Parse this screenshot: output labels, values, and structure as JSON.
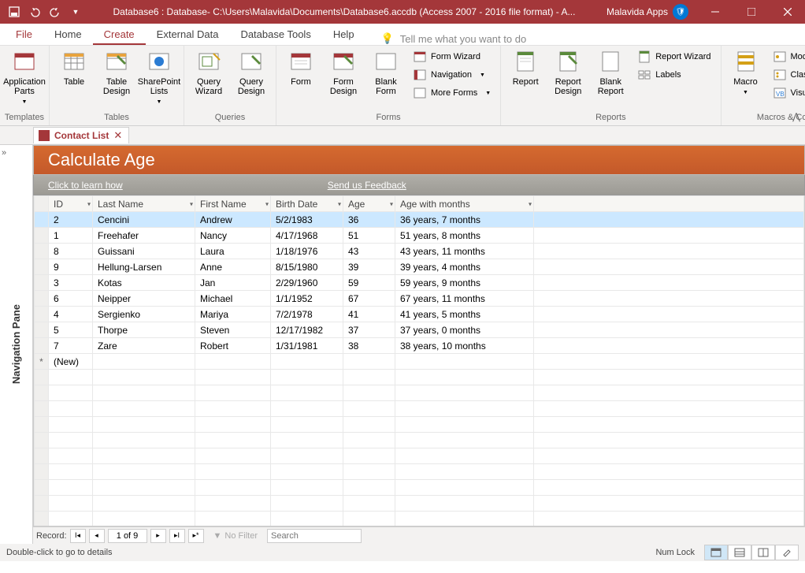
{
  "titlebar": {
    "title": "Database6 : Database- C:\\Users\\Malavida\\Documents\\Database6.accdb (Access 2007 - 2016 file format) -  A...",
    "app_badge": "Malavida Apps"
  },
  "ribbon": {
    "tabs": [
      "File",
      "Home",
      "Create",
      "External Data",
      "Database Tools",
      "Help"
    ],
    "active_tab": "Create",
    "tell_me_placeholder": "Tell me what you want to do",
    "groups": {
      "templates": {
        "label": "Templates",
        "application_parts": "Application\nParts"
      },
      "tables": {
        "label": "Tables",
        "table": "Table",
        "table_design": "Table\nDesign",
        "sharepoint_lists": "SharePoint\nLists"
      },
      "queries": {
        "label": "Queries",
        "query_wizard": "Query\nWizard",
        "query_design": "Query\nDesign"
      },
      "forms": {
        "label": "Forms",
        "form": "Form",
        "form_design": "Form\nDesign",
        "blank_form": "Blank\nForm",
        "form_wizard": "Form Wizard",
        "navigation": "Navigation",
        "more_forms": "More Forms"
      },
      "reports": {
        "label": "Reports",
        "report": "Report",
        "report_design": "Report\nDesign",
        "blank_report": "Blank\nReport",
        "report_wizard": "Report Wizard",
        "labels": "Labels"
      },
      "macros": {
        "label": "Macros & Code",
        "macro": "Macro",
        "module": "Module",
        "class_module": "Class Module",
        "visual_basic": "Visual Basic"
      }
    }
  },
  "doc_tab": {
    "label": "Contact List"
  },
  "nav_pane_label": "Navigation Pane",
  "form": {
    "title": "Calculate Age",
    "learn_link": "Click to learn how",
    "feedback_link": "Send us Feedback"
  },
  "grid": {
    "columns": [
      "ID",
      "Last Name",
      "First Name",
      "Birth Date",
      "Age",
      "Age with months"
    ],
    "new_row_label": "(New)",
    "rows": [
      {
        "id": "2",
        "last": "Cencini",
        "first": "Andrew",
        "birth": "5/2/1983",
        "age": "36",
        "agem": "36 years, 7 months"
      },
      {
        "id": "1",
        "last": "Freehafer",
        "first": "Nancy",
        "birth": "4/17/1968",
        "age": "51",
        "agem": "51 years, 8 months"
      },
      {
        "id": "8",
        "last": "Guissani",
        "first": "Laura",
        "birth": "1/18/1976",
        "age": "43",
        "agem": "43 years, 11 months"
      },
      {
        "id": "9",
        "last": "Hellung-Larsen",
        "first": "Anne",
        "birth": "8/15/1980",
        "age": "39",
        "agem": "39 years, 4 months"
      },
      {
        "id": "3",
        "last": "Kotas",
        "first": "Jan",
        "birth": "2/29/1960",
        "age": "59",
        "agem": "59 years, 9 months"
      },
      {
        "id": "6",
        "last": "Neipper",
        "first": "Michael",
        "birth": "1/1/1952",
        "age": "67",
        "agem": "67 years, 11 months"
      },
      {
        "id": "4",
        "last": "Sergienko",
        "first": "Mariya",
        "birth": "7/2/1978",
        "age": "41",
        "agem": "41 years, 5 months"
      },
      {
        "id": "5",
        "last": "Thorpe",
        "first": "Steven",
        "birth": "12/17/1982",
        "age": "37",
        "agem": "37 years, 0 months"
      },
      {
        "id": "7",
        "last": "Zare",
        "first": "Robert",
        "birth": "1/31/1981",
        "age": "38",
        "agem": "38 years, 10 months"
      }
    ]
  },
  "record_nav": {
    "label": "Record:",
    "position": "1 of 9",
    "no_filter": "No Filter",
    "search_placeholder": "Search"
  },
  "statusbar": {
    "status": "Double-click to go to details",
    "numlock": "Num Lock"
  }
}
